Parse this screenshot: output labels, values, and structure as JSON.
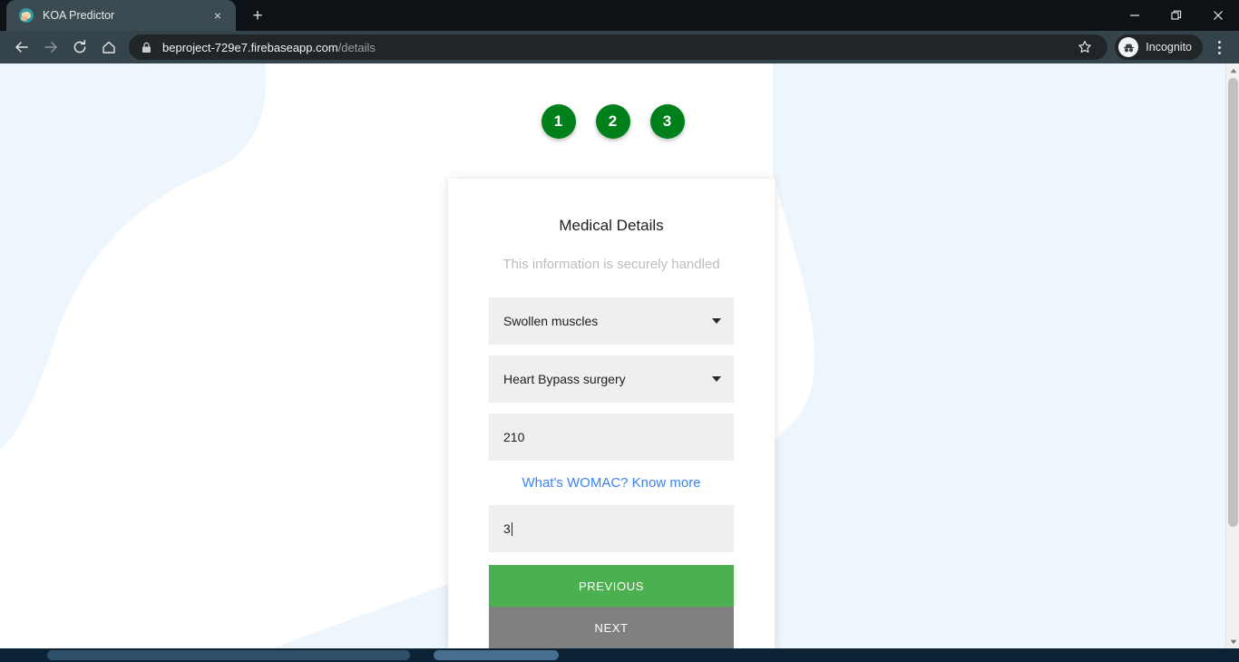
{
  "browser": {
    "tab": {
      "title": "KOA Predictor",
      "favicon_name": "koa-favicon",
      "close_label": "×"
    },
    "new_tab_label": "+",
    "window_controls": {
      "minimize": "minimize-icon",
      "restore": "restore-icon",
      "close": "close-icon"
    },
    "toolbar": {
      "back": "back-arrow-icon",
      "forward": "forward-arrow-icon",
      "reload": "reload-icon",
      "home": "home-icon",
      "lock": "lock-icon",
      "url_host": "beproject-729e7.firebaseapp.com",
      "url_path": "/details",
      "bookmark": "star-icon",
      "incognito_label": "Incognito",
      "menu": "kebab-menu-icon"
    }
  },
  "page": {
    "steps": [
      {
        "number": "1"
      },
      {
        "number": "2"
      },
      {
        "number": "3"
      }
    ],
    "card": {
      "title": "Medical Details",
      "subtitle": "This information is securely handled",
      "fields": [
        {
          "name": "symptom-select",
          "value": "Swollen muscles",
          "type": "select"
        },
        {
          "name": "surgery-select",
          "value": "Heart Bypass surgery",
          "type": "select"
        },
        {
          "name": "weight-input",
          "value": "210",
          "type": "text"
        },
        {
          "name": "womac-input",
          "value": "3",
          "type": "text",
          "focused": true
        }
      ],
      "womac_link": "What's WOMAC? Know more",
      "buttons": {
        "previous": "PREVIOUS",
        "next": "NEXT"
      }
    },
    "colors": {
      "step_green": "#00801b",
      "previous_green": "#4caf50",
      "next_gray": "#808080",
      "link_blue": "#3b82f6",
      "blob_blue": "#edf5fd",
      "field_gray": "#efefef"
    }
  }
}
